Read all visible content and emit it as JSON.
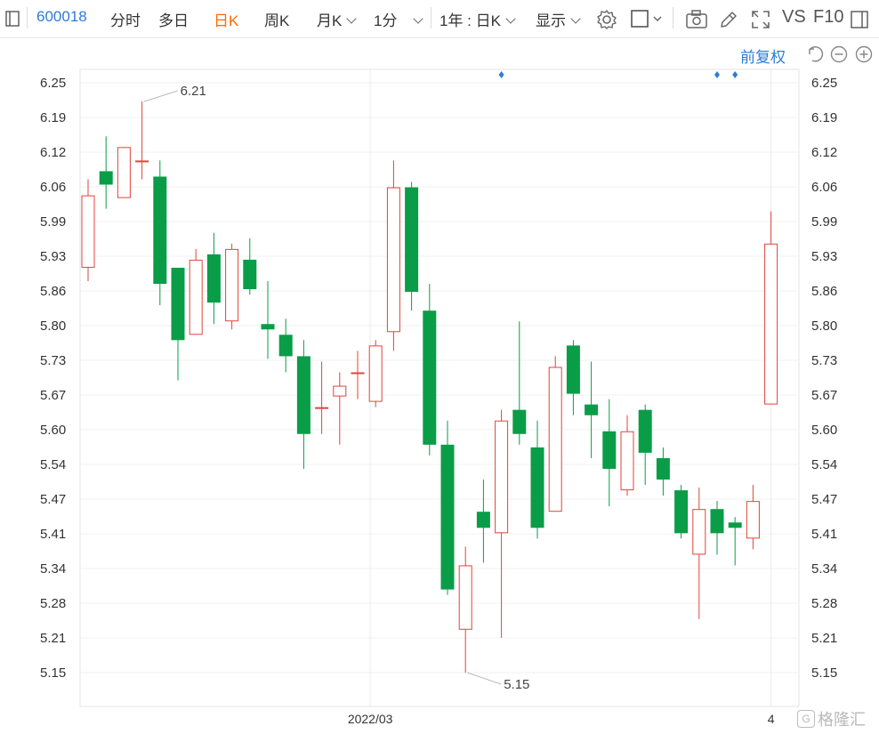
{
  "toolbar": {
    "code": "600018",
    "tabs": [
      "分时",
      "多日",
      "日K",
      "周K"
    ],
    "active_tab": "日K",
    "month_k": "月K",
    "minute": "1分",
    "range": "1年 : 日K",
    "display": "显示",
    "vs": "VS",
    "f10": "F10"
  },
  "adjust": {
    "label": "前复权"
  },
  "colors": {
    "up": "#e2433e",
    "down": "#0a9d48",
    "accent": "#2e7bd6",
    "active": "#ff6a00"
  },
  "chart_data": {
    "type": "candlestick",
    "y_ticks": [
      "6.25",
      "6.19",
      "6.12",
      "6.06",
      "5.99",
      "5.93",
      "5.86",
      "5.80",
      "5.73",
      "5.67",
      "5.60",
      "5.54",
      "5.47",
      "5.41",
      "5.34",
      "5.28",
      "5.21",
      "5.15"
    ],
    "ylim": [
      5.15,
      6.25
    ],
    "x_labels": [
      {
        "label": "2022/03",
        "index": 15.7
      },
      {
        "label": "4",
        "index": 38
      }
    ],
    "annotations": [
      {
        "label": "6.21",
        "index": 3,
        "value": 6.215
      },
      {
        "label": "5.15",
        "index": 21,
        "value": 5.15
      }
    ],
    "markers_at_index": [
      23,
      35,
      36
    ],
    "candles": [
      {
        "o": 5.905,
        "c": 6.04,
        "h": 6.07,
        "l": 5.88
      },
      {
        "o": 6.085,
        "c": 6.06,
        "h": 6.15,
        "l": 6.015
      },
      {
        "o": 6.035,
        "c": 6.13,
        "h": 6.13,
        "l": 6.035
      },
      {
        "o": 6.105,
        "c": 6.105,
        "h": 6.215,
        "l": 6.07
      },
      {
        "o": 6.075,
        "c": 5.875,
        "h": 6.105,
        "l": 5.835
      },
      {
        "o": 5.905,
        "c": 5.77,
        "h": 5.905,
        "l": 5.695
      },
      {
        "o": 5.78,
        "c": 5.92,
        "h": 5.94,
        "l": 5.78
      },
      {
        "o": 5.93,
        "c": 5.84,
        "h": 5.97,
        "l": 5.8
      },
      {
        "o": 5.805,
        "c": 5.94,
        "h": 5.95,
        "l": 5.79
      },
      {
        "o": 5.92,
        "c": 5.865,
        "h": 5.96,
        "l": 5.855
      },
      {
        "o": 5.8,
        "c": 5.79,
        "h": 5.88,
        "l": 5.735
      },
      {
        "o": 5.78,
        "c": 5.74,
        "h": 5.81,
        "l": 5.71
      },
      {
        "o": 5.74,
        "c": 5.595,
        "h": 5.77,
        "l": 5.53
      },
      {
        "o": 5.645,
        "c": 5.645,
        "h": 5.73,
        "l": 5.595
      },
      {
        "o": 5.665,
        "c": 5.685,
        "h": 5.71,
        "l": 5.575
      },
      {
        "o": 5.71,
        "c": 5.71,
        "h": 5.75,
        "l": 5.66
      },
      {
        "o": 5.655,
        "c": 5.76,
        "h": 5.77,
        "l": 5.645
      },
      {
        "o": 5.785,
        "c": 6.055,
        "h": 6.105,
        "l": 5.75
      },
      {
        "o": 6.055,
        "c": 5.86,
        "h": 6.065,
        "l": 5.825
      },
      {
        "o": 5.825,
        "c": 5.575,
        "h": 5.875,
        "l": 5.555
      },
      {
        "o": 5.575,
        "c": 5.305,
        "h": 5.62,
        "l": 5.295
      },
      {
        "o": 5.23,
        "c": 5.35,
        "h": 5.385,
        "l": 5.15
      },
      {
        "o": 5.45,
        "c": 5.42,
        "h": 5.51,
        "l": 5.355
      },
      {
        "o": 5.41,
        "c": 5.62,
        "h": 5.64,
        "l": 5.215
      },
      {
        "o": 5.64,
        "c": 5.595,
        "h": 5.805,
        "l": 5.575
      },
      {
        "o": 5.57,
        "c": 5.42,
        "h": 5.62,
        "l": 5.4
      },
      {
        "o": 5.45,
        "c": 5.72,
        "h": 5.74,
        "l": 5.45
      },
      {
        "o": 5.76,
        "c": 5.67,
        "h": 5.77,
        "l": 5.63
      },
      {
        "o": 5.65,
        "c": 5.63,
        "h": 5.73,
        "l": 5.55
      },
      {
        "o": 5.6,
        "c": 5.53,
        "h": 5.66,
        "l": 5.46
      },
      {
        "o": 5.49,
        "c": 5.6,
        "h": 5.63,
        "l": 5.48
      },
      {
        "o": 5.64,
        "c": 5.56,
        "h": 5.65,
        "l": 5.5
      },
      {
        "o": 5.55,
        "c": 5.51,
        "h": 5.57,
        "l": 5.48
      },
      {
        "o": 5.49,
        "c": 5.41,
        "h": 5.5,
        "l": 5.4
      },
      {
        "o": 5.37,
        "c": 5.455,
        "h": 5.495,
        "l": 5.25
      },
      {
        "o": 5.455,
        "c": 5.41,
        "h": 5.47,
        "l": 5.37
      },
      {
        "o": 5.43,
        "c": 5.42,
        "h": 5.44,
        "l": 5.35
      },
      {
        "o": 5.4,
        "c": 5.47,
        "h": 5.5,
        "l": 5.38
      },
      {
        "o": 5.65,
        "c": 5.95,
        "h": 6.01,
        "l": 5.65
      }
    ]
  },
  "footer": {
    "brand": "格隆汇"
  }
}
